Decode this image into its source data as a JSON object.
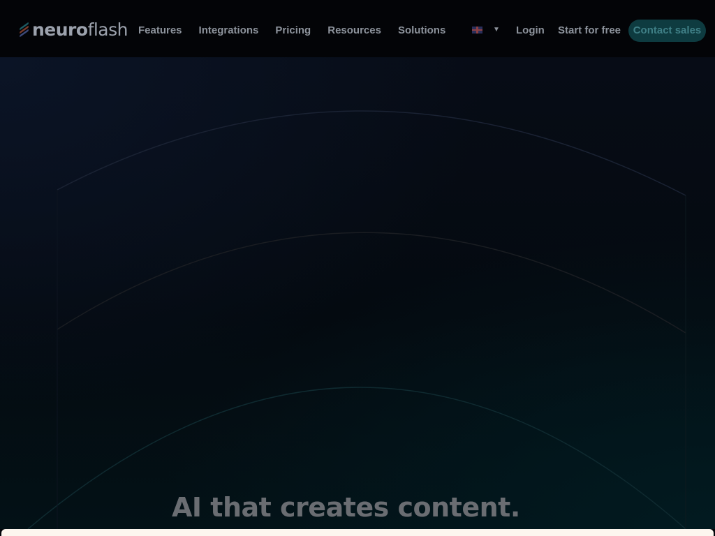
{
  "header": {
    "logo_bold": "neuro",
    "logo_light": "flash",
    "nav": [
      {
        "label": "Features"
      },
      {
        "label": "Integrations"
      },
      {
        "label": "Pricing"
      },
      {
        "label": "Resources"
      },
      {
        "label": "Solutions"
      }
    ],
    "language": {
      "icon": "uk-flag-icon",
      "caret_icon": "chevron-down-icon",
      "caret": "▼"
    },
    "login_label": "Login",
    "start_label": "Start for free",
    "contact_label": "Contact sales"
  },
  "hero": {
    "headline": "AI that creates content."
  },
  "colors": {
    "background": "#04060b",
    "accent": "#0e3b40",
    "accent_text": "#3f7f86",
    "nav_text": "#8d939c"
  }
}
